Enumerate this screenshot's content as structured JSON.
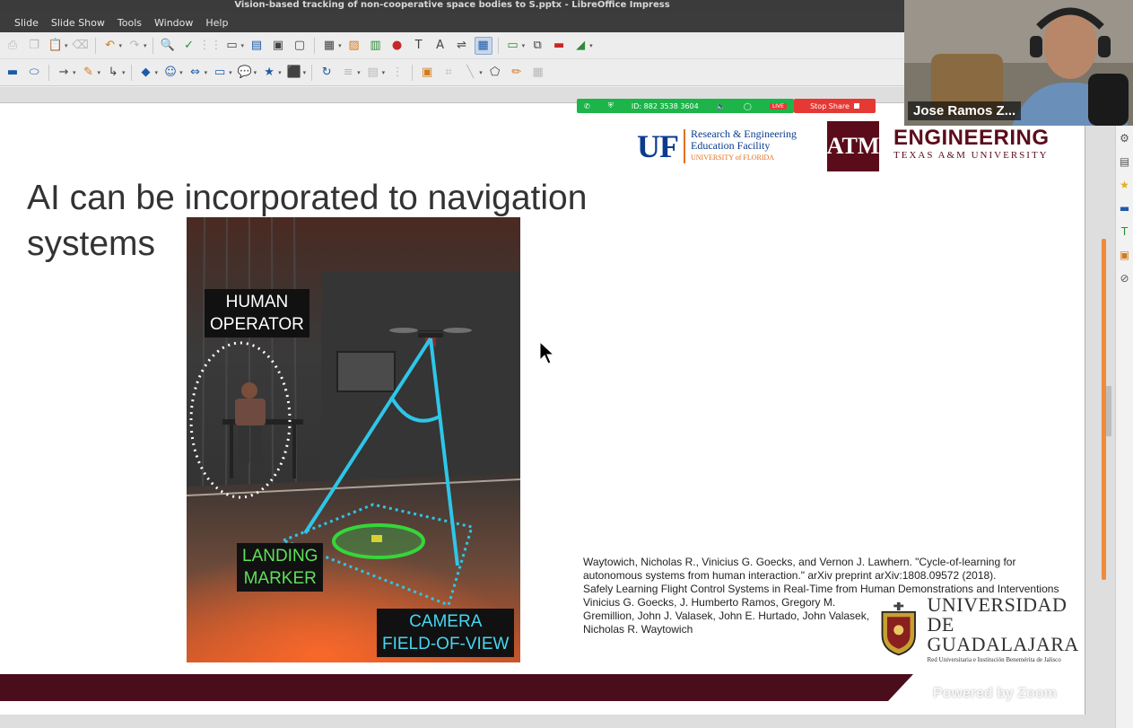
{
  "window": {
    "title": "Vision-based tracking of non-cooperative space bodies to S.pptx - LibreOffice Impress"
  },
  "menu": {
    "items": [
      "Slide",
      "Slide Show",
      "Tools",
      "Window",
      "Help"
    ]
  },
  "slide": {
    "title": "AI can be incorporated to navigation systems",
    "photo_labels": {
      "human_operator": [
        "HUMAN",
        "OPERATOR"
      ],
      "landing_marker": [
        "LANDING",
        "MARKER"
      ],
      "camera_fov": [
        "CAMERA",
        "FIELD-OF-VIEW"
      ]
    },
    "logos": {
      "uf_mark": "UF",
      "uf_line1": "Research & Engineering",
      "uf_line2": "Education Facility",
      "uf_line3": "UNIVERSITY of FLORIDA",
      "tamu_mark": "ATM",
      "tamu_engineering": "ENGINEERING",
      "tamu_university": "TEXAS A&M UNIVERSITY",
      "udg_line1": "UNIVERSIDAD DE",
      "udg_line2": "GUADALAJARA",
      "udg_tag": "Red Universitaria e Institución Benemérita de Jalisco"
    },
    "references": [
      "Waytowich, Nicholas R., Vinicius G. Goecks, and Vernon J. Lawhern. \"Cycle-of-learning for autonomous systems from human interaction.\" arXiv preprint arXiv:1808.09572 (2018).",
      "Safely Learning Flight Control Systems in Real-Time from Human Demonstrations and Interventions",
      "Vinicius G. Goecks, J. Humberto Ramos, Gregory M. Gremillion, John J. Valasek, John E. Hurtado, John Valasek, Nicholas R. Waytowich"
    ]
  },
  "zoom": {
    "meeting_id": "ID: 882 3538 3604",
    "live_badge": "LIVE",
    "stop_share": "Stop Share",
    "participant_name": "Jose Ramos Z...",
    "powered_by": "Powered by Zoom"
  },
  "colors": {
    "bottom_bar": "#4a0d1c",
    "zoom_green": "#1db54a",
    "stop_share_red": "#e53935",
    "label_green": "#5fe05a",
    "label_cyan": "#46d6f0",
    "fov_cyan": "#2ec6e8",
    "tamu_maroon": "#5b0c1a",
    "uf_blue": "#0b3b8f"
  }
}
